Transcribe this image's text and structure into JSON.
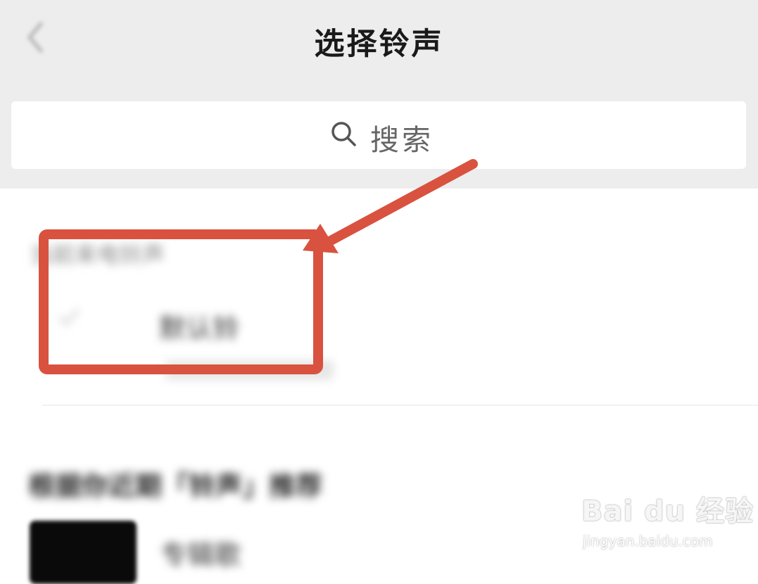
{
  "header": {
    "title": "选择铃声",
    "back_icon": "chevron-left-icon"
  },
  "search": {
    "icon": "search-icon",
    "placeholder": "搜索"
  },
  "section_current": {
    "header": "当前来电铃声",
    "ringtone_name": "默认铃",
    "ringtone_sub": ""
  },
  "section_recommend": {
    "header": "根据你近期「铃声」推荐",
    "song_title": "专辑歌"
  },
  "annotation": {
    "color": "#d9523f",
    "type": "highlight-box-with-arrow"
  },
  "watermark": {
    "logo": "Bai du 经验",
    "url": "jingyan.baidu.com"
  }
}
